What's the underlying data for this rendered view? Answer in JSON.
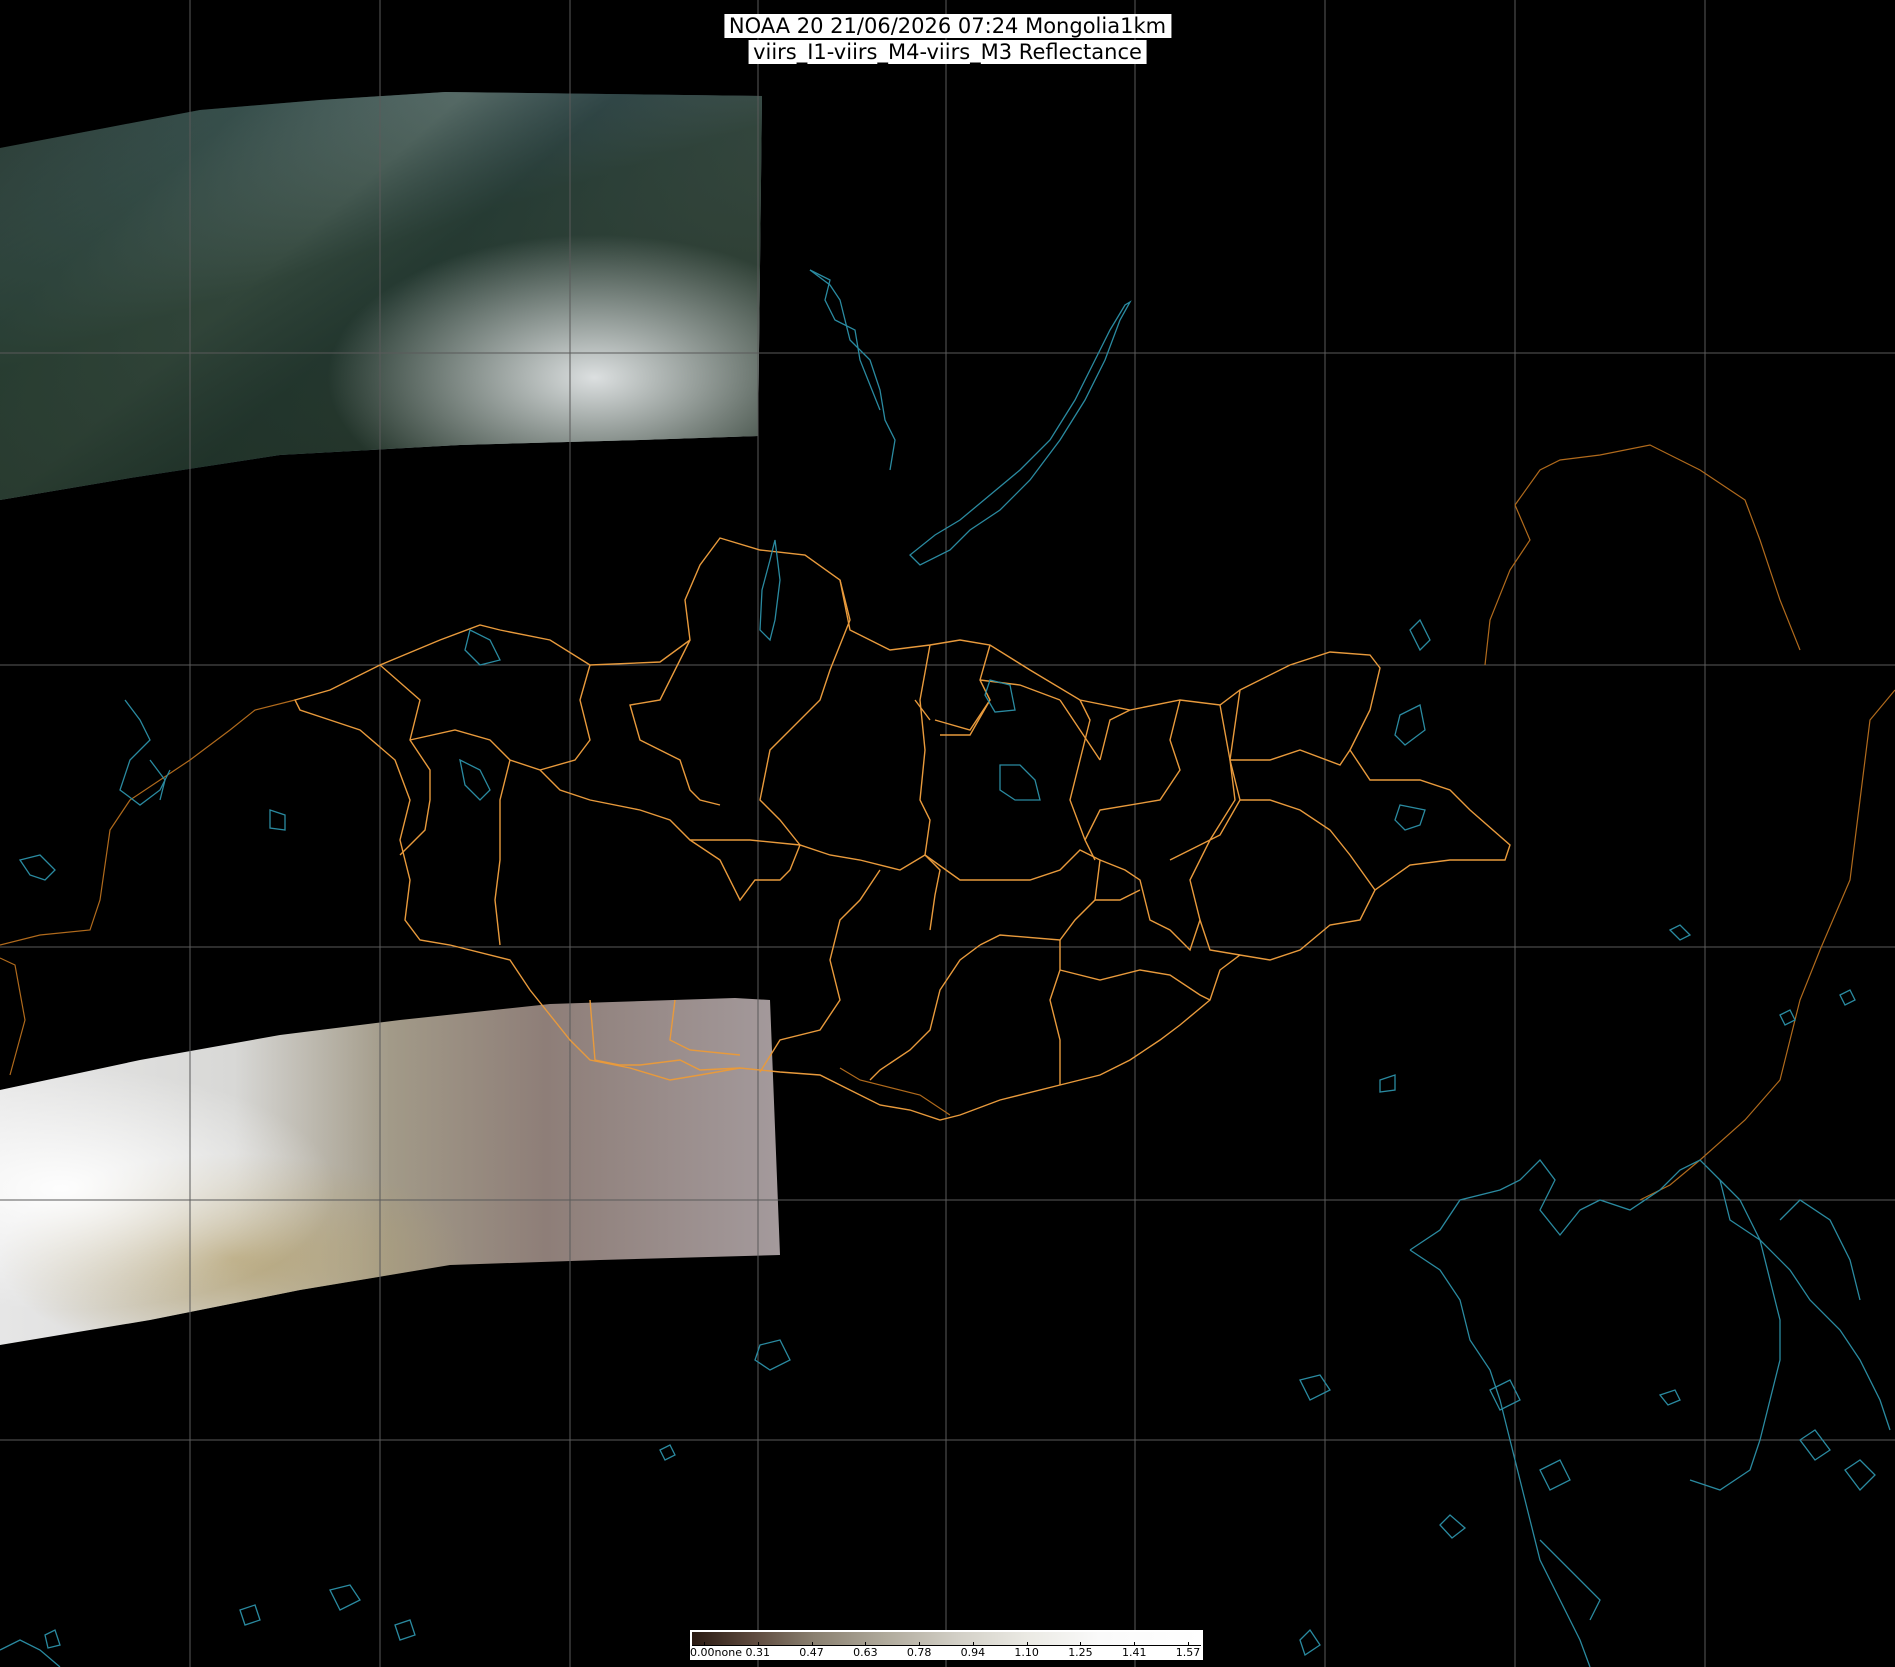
{
  "title": {
    "line1": "NOAA 20 21/06/2026 07:24 Mongolia1km",
    "line2": "viirs_I1-viirs_M4-viirs_M3 Reflectance"
  },
  "legend": {
    "ticks": [
      "0.00none",
      "0.31",
      "0.47",
      "0.63",
      "0.78",
      "0.94",
      "1.10",
      "1.25",
      "1.41",
      "1.57"
    ]
  },
  "colors": {
    "background": "#000000",
    "graticule": "#5a5a5a",
    "country_border": "#c8791e",
    "admin_border": "#e89a3c",
    "water": "#2a8aa0"
  },
  "layers": {
    "imagery_swaths": [
      "north-swath",
      "south-swath"
    ],
    "overlays": [
      "graticule",
      "country-borders",
      "mongolia-provinces",
      "lakes-and-coastlines"
    ]
  }
}
